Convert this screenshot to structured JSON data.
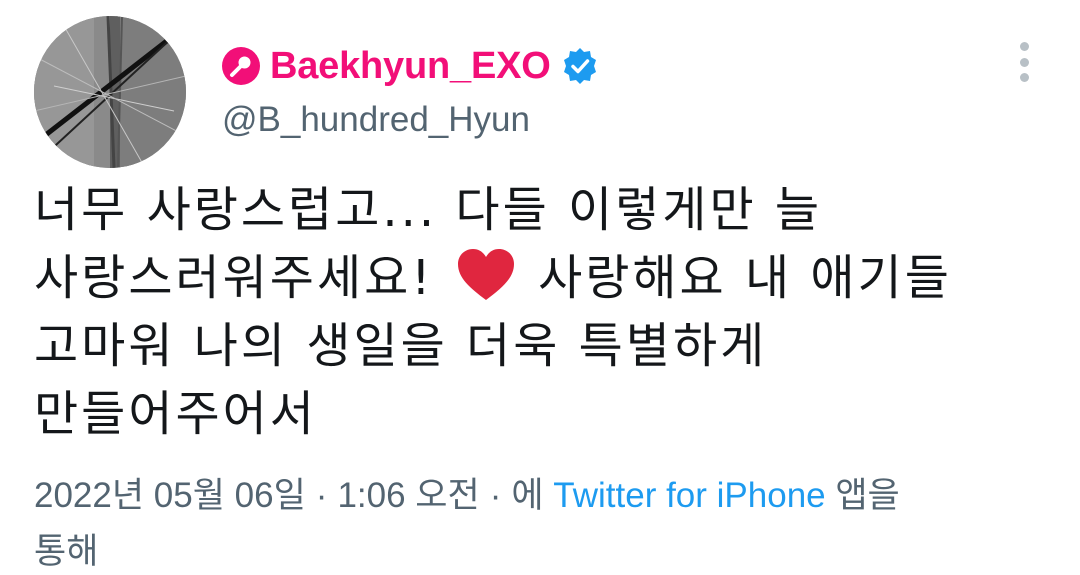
{
  "author": {
    "display_name": "Baekhyun_EXO",
    "handle": "@B_hundred_Hyun",
    "verified": true,
    "name_color": "#f20f78",
    "badge_icon": "microphone-icon",
    "verified_icon": "verified-badge-icon"
  },
  "tweet": {
    "lines": [
      "너무 사랑스럽고... 다들 이렇게만 늘",
      "사랑스러워주세요!",
      "사랑해요 내 애기들",
      "고마워 나의 생일을 더욱 특별하게",
      "만들어주어서"
    ],
    "emoji": "heart-icon"
  },
  "meta": {
    "date": "2022년 05월 06일",
    "separator": "·",
    "time": "1:06 오전",
    "via_prefix": "에",
    "source": "Twitter for iPhone",
    "via_suffix": "앱을",
    "via_line2": "통해"
  },
  "colors": {
    "secondary_text": "#536471",
    "link": "#1d9bf0",
    "heart": "#e0263f"
  }
}
